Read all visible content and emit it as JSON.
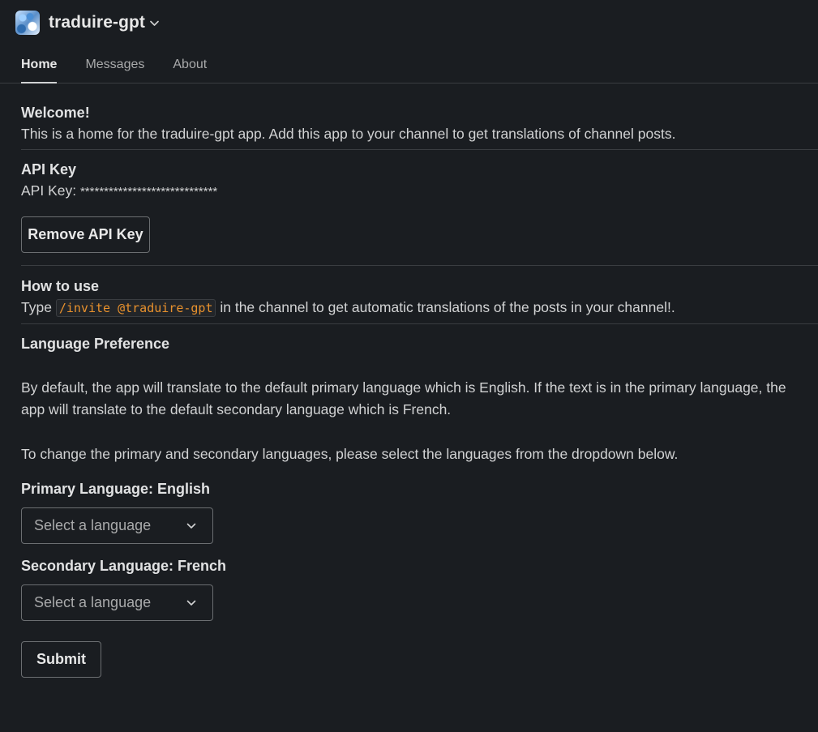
{
  "app": {
    "name": "traduire-gpt",
    "icon": "app-avatar-icon"
  },
  "tabs": [
    {
      "label": "Home",
      "active": true
    },
    {
      "label": "Messages",
      "active": false
    },
    {
      "label": "About",
      "active": false
    }
  ],
  "welcome": {
    "title": "Welcome!",
    "text": "This is a home for the traduire-gpt app. Add this app to your channel to get translations of channel posts."
  },
  "api_key": {
    "title": "API Key",
    "label": "API Key:",
    "value": "*****************************",
    "remove_button": "Remove API Key"
  },
  "how_to_use": {
    "title": "How to use",
    "prefix": "Type",
    "command": "/invite @traduire-gpt",
    "suffix": "in the channel to get automatic translations of the posts in your channel!."
  },
  "language_preference": {
    "title": "Language Preference",
    "paragraph1": "By default, the app will translate to the default primary language which is English. If the text is in the primary language, the app will translate to the default secondary language which is French.",
    "paragraph2": "To change the primary and secondary languages, please select the languages from the dropdown below.",
    "primary_label": "Primary Language: English",
    "primary_placeholder": "Select a language",
    "secondary_label": "Secondary Language: French",
    "secondary_placeholder": "Select a language",
    "submit": "Submit"
  },
  "colors": {
    "background": "#1a1d21",
    "text": "#d1d2d3",
    "code_text": "#e8912d",
    "border": "#6b6e71"
  }
}
